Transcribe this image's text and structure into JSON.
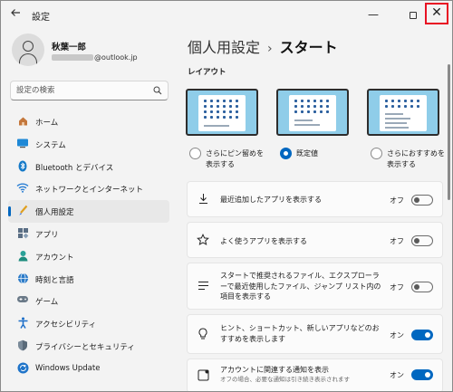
{
  "window": {
    "title": "設定",
    "back_icon": "back-arrow-icon",
    "minimize_glyph": "—",
    "maximize_glyph": "☐",
    "close_glyph": "✕",
    "close_highlight_color": "#e81123"
  },
  "profile": {
    "name": "秋葉一郎",
    "email_visible": "@outlook.jp"
  },
  "search": {
    "placeholder": "設定の検索"
  },
  "sidebar": {
    "items": [
      {
        "label": "ホーム",
        "icon": "home-icon",
        "active": false
      },
      {
        "label": "システム",
        "icon": "system-icon",
        "active": false
      },
      {
        "label": "Bluetooth とデバイス",
        "icon": "bluetooth-icon",
        "active": false
      },
      {
        "label": "ネットワークとインターネット",
        "icon": "network-icon",
        "active": false
      },
      {
        "label": "個人用設定",
        "icon": "personalization-icon",
        "active": true
      },
      {
        "label": "アプリ",
        "icon": "apps-icon",
        "active": false
      },
      {
        "label": "アカウント",
        "icon": "account-icon",
        "active": false
      },
      {
        "label": "時刻と言語",
        "icon": "time-language-icon",
        "active": false
      },
      {
        "label": "ゲーム",
        "icon": "gaming-icon",
        "active": false
      },
      {
        "label": "アクセシビリティ",
        "icon": "accessibility-icon",
        "active": false
      },
      {
        "label": "プライバシーとセキュリティ",
        "icon": "privacy-shield-icon",
        "active": false
      },
      {
        "label": "Windows Update",
        "icon": "windows-update-icon",
        "active": false
      }
    ]
  },
  "main": {
    "breadcrumb_parent": "個人用設定",
    "breadcrumb_separator": "›",
    "breadcrumb_current": "スタート",
    "layout_section_label": "レイアウト",
    "layout_options": [
      {
        "label_line1": "さらにピン留めを",
        "label_line2": "表示する",
        "selected": false
      },
      {
        "label_line1": "既定値",
        "label_line2": "",
        "selected": true
      },
      {
        "label_line1": "さらにおすすめを",
        "label_line2": "表示する",
        "selected": false
      }
    ],
    "settings": [
      {
        "icon": "download-icon",
        "text": "最近追加したアプリを表示する",
        "sub": "",
        "state_label": "オフ",
        "on": false
      },
      {
        "icon": "star-icon",
        "text": "よく使うアプリを表示する",
        "sub": "",
        "state_label": "オフ",
        "on": false
      },
      {
        "icon": "list-lines-icon",
        "text": "スタートで推奨されるファイル、エクスプローラーで最近使用したファイル、ジャンプ リスト内の項目を表示する",
        "sub": "",
        "state_label": "オフ",
        "on": false
      },
      {
        "icon": "lightbulb-icon",
        "text": "ヒント、ショートカット、新しいアプリなどのおすすめを表示します",
        "sub": "",
        "state_label": "オン",
        "on": true
      },
      {
        "icon": "account-notification-icon",
        "text": "アカウントに関連する通知を表示",
        "sub": "オフの場合、必要な通知は引き続き表示されます",
        "state_label": "オン",
        "on": true
      }
    ]
  }
}
